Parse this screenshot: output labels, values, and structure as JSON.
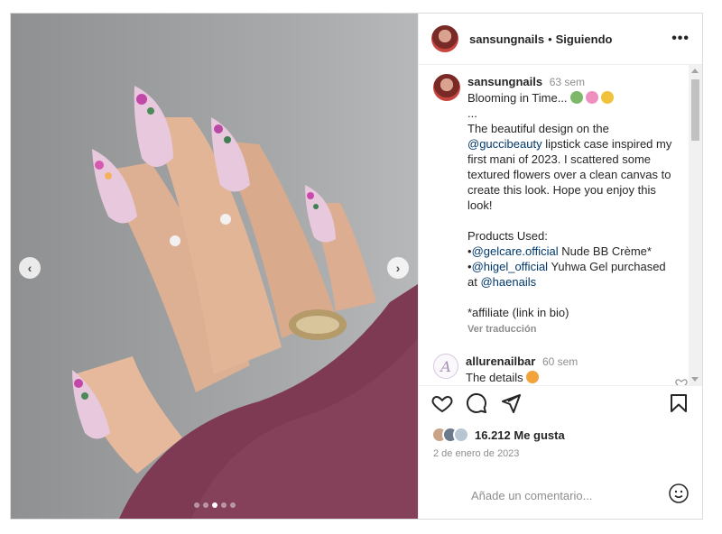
{
  "post": {
    "username": "sansungnails",
    "separator": "•",
    "follow_label": "Siguiendo",
    "more_label": "•••",
    "likes": "16.212 Me gusta",
    "date": "2 de enero de 2023",
    "add_comment_placeholder": "Añade un comentario..."
  },
  "caption": {
    "username": "sansungnails",
    "time": "63 sem",
    "title": "Blooming in Time...",
    "line_dots": "...",
    "p1_a": "The beautiful design on the ",
    "p1_link": "@guccibeauty",
    "p1_b": " lipstick case inspired my first mani of 2023. I scattered some textured flowers over a clean canvas to create this look. Hope you enjoy this look!",
    "products_label": "Products Used:",
    "prod1_bullet": "•",
    "prod1_link": "@gelcare.official",
    "prod1_text": " Nude BB Crème*",
    "prod2_bullet": "•",
    "prod2_link": "@higel_official",
    "prod2_text": " Yuhwa Gel purchased at ",
    "prod2_link2": "@haenails",
    "affiliate": "*affiliate (link in bio)",
    "translate": "Ver traducción"
  },
  "comments": [
    {
      "username": "allurenailbar",
      "time": "60 sem",
      "text": "The details",
      "avatar_letter": "A"
    }
  ],
  "carousel": {
    "prev_icon": "‹",
    "next_icon": "›",
    "dots": 5,
    "active_index": 2
  },
  "colors": {
    "sweater": "#7e3a52",
    "nail_pink": "#e8c8dd",
    "link": "#00376b",
    "muted": "#8e8e8e"
  },
  "icons": {
    "heart": "heart-icon",
    "comment": "comment-icon",
    "share": "share-icon",
    "save": "bookmark-icon",
    "emoji": "smiley-icon"
  }
}
